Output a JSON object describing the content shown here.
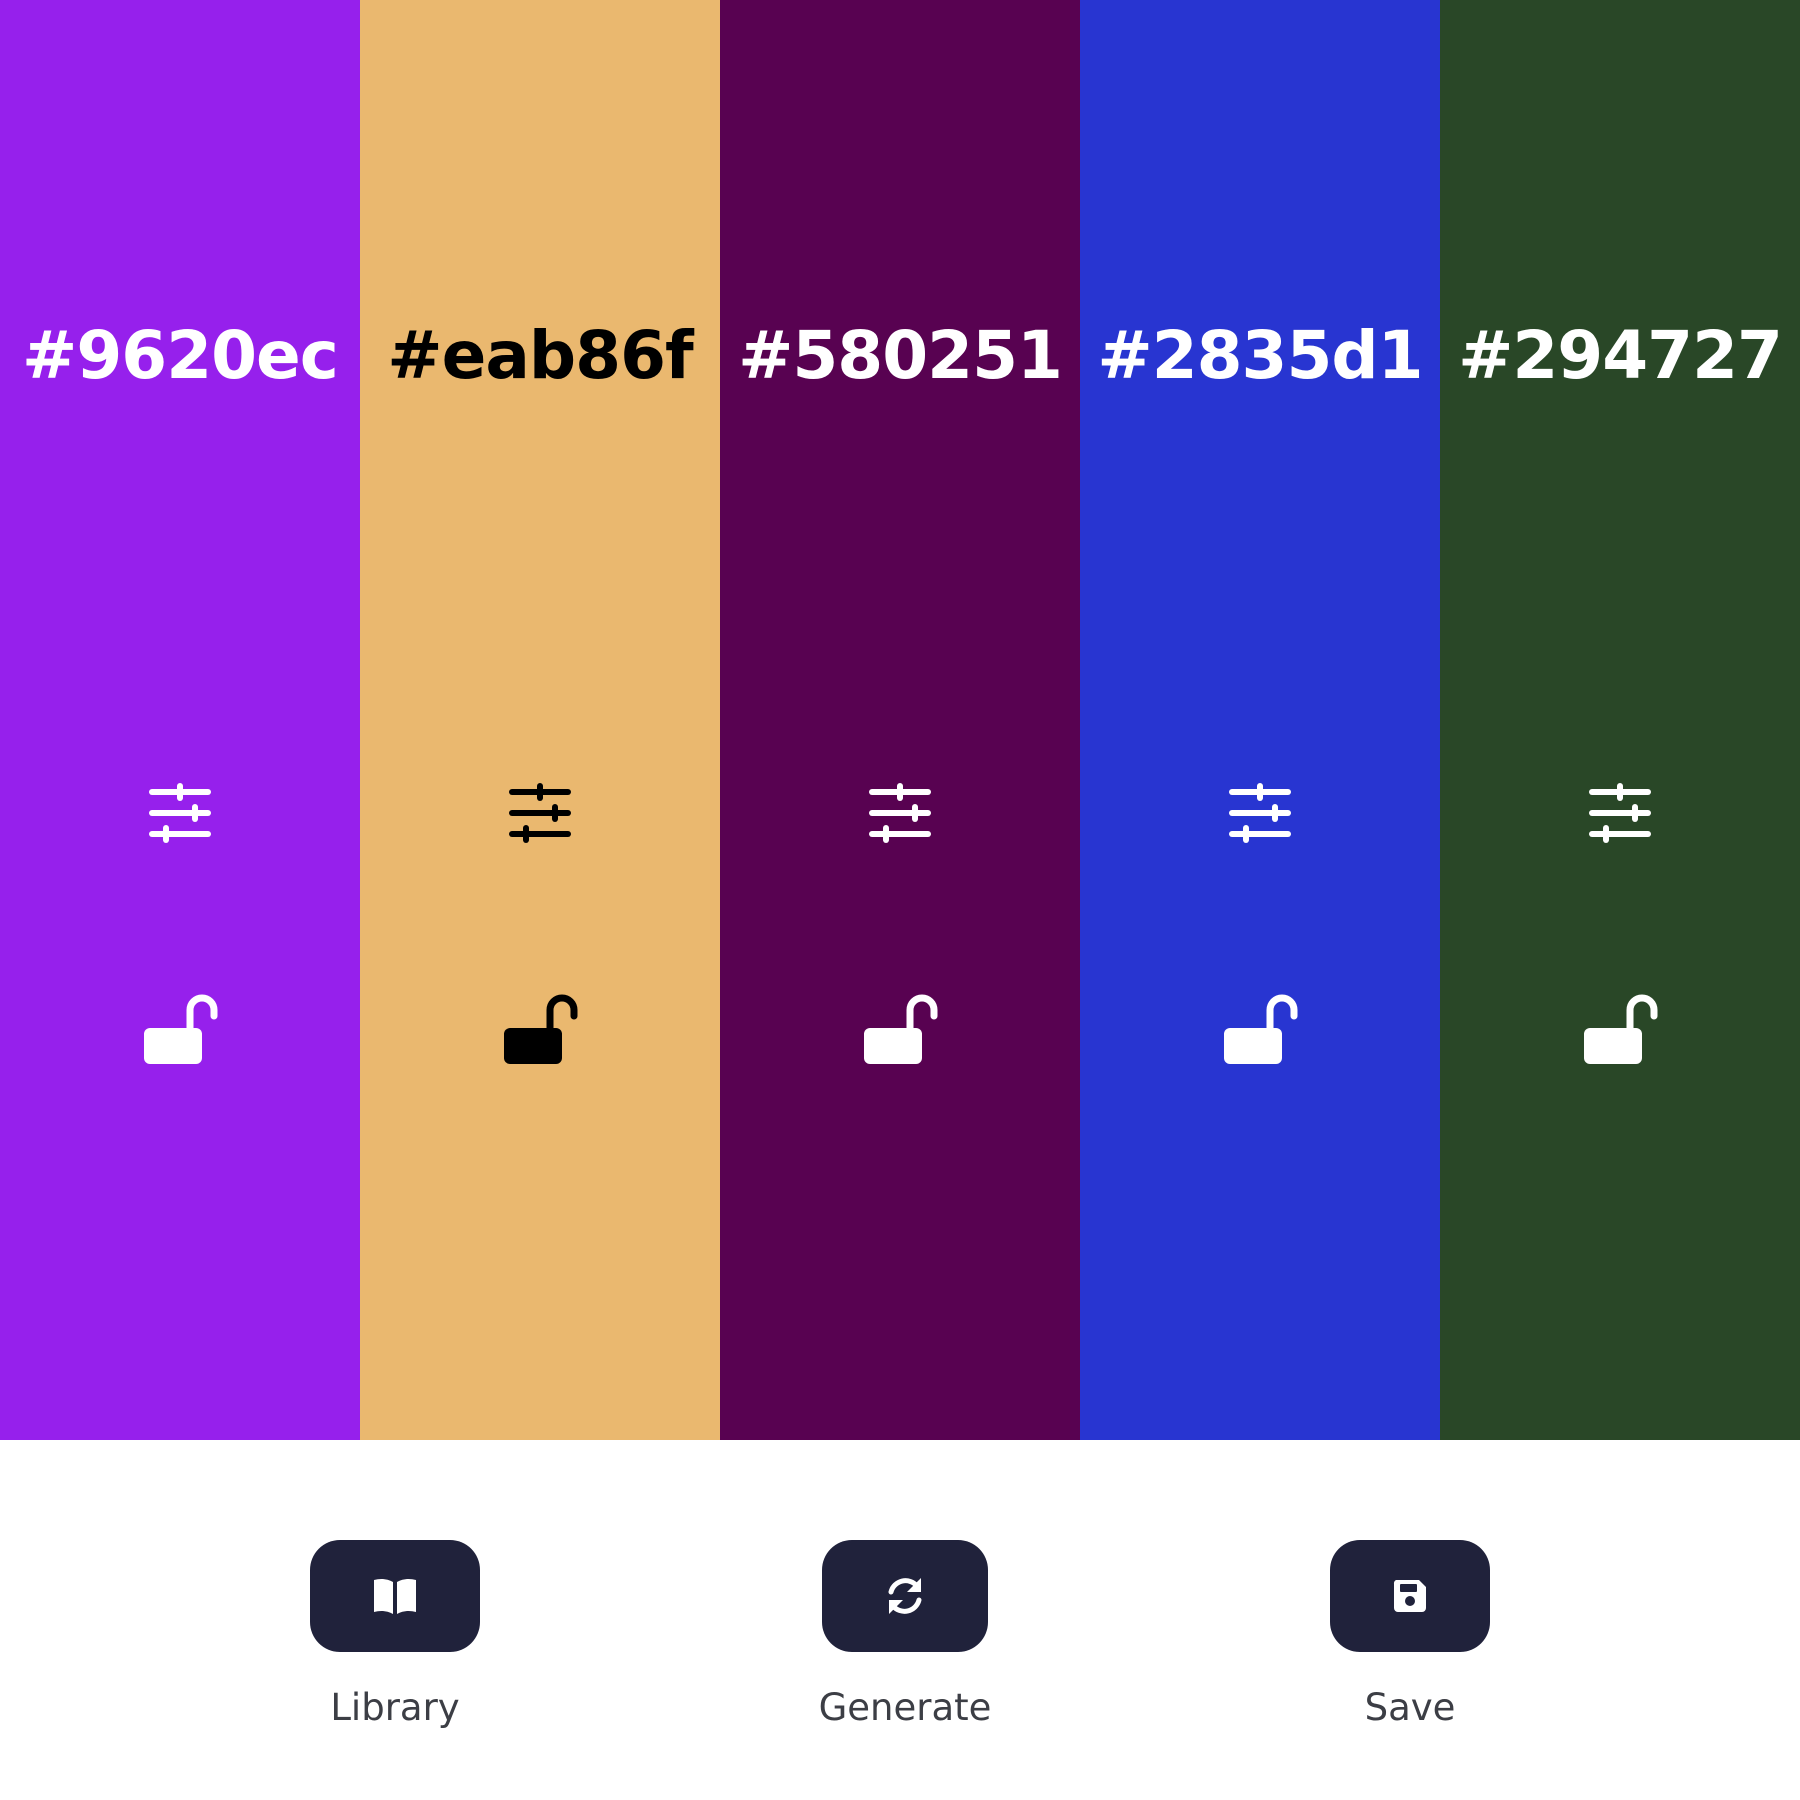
{
  "palette": {
    "swatches": [
      {
        "hex": "#9620ec",
        "color": "#9620ec",
        "fg": "#ffffff",
        "locked": false
      },
      {
        "hex": "#eab86f",
        "color": "#eab86f",
        "fg": "#000000",
        "locked": false
      },
      {
        "hex": "#580251",
        "color": "#580251",
        "fg": "#ffffff",
        "locked": false
      },
      {
        "hex": "#2835d1",
        "color": "#2835d1",
        "fg": "#ffffff",
        "locked": false
      },
      {
        "hex": "#294727",
        "color": "#294727",
        "fg": "#ffffff",
        "locked": false
      }
    ],
    "icons": {
      "adjust": "sliders-icon",
      "lock": "unlock-icon"
    }
  },
  "toolbar": {
    "button_color": "#20223b",
    "library": {
      "label": "Library",
      "icon": "book-icon"
    },
    "generate": {
      "label": "Generate",
      "icon": "refresh-icon"
    },
    "save": {
      "label": "Save",
      "icon": "floppy-disk-icon"
    }
  }
}
